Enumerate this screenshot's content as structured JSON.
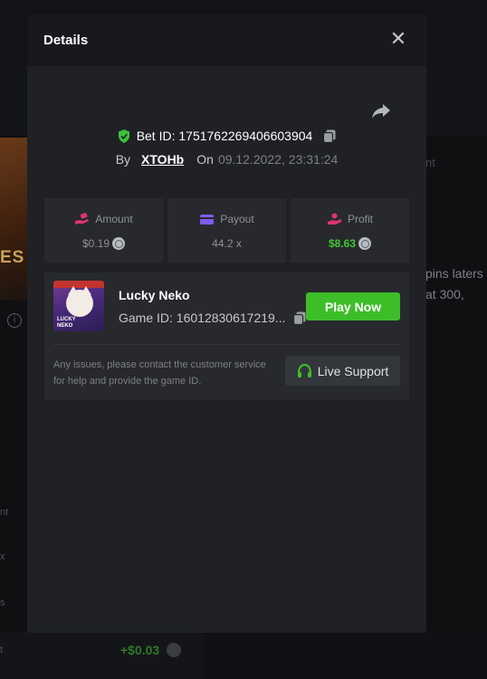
{
  "background": {
    "left_card_text": "ES",
    "right_text_top": "nt",
    "right_text_line1": "pins laters",
    "right_text_line2": "at 300,",
    "left_labels": [
      "nt",
      "x",
      "s",
      "t"
    ],
    "profit_value": "+$0.03"
  },
  "modal": {
    "title": "Details",
    "close_icon": "close-icon",
    "share_icon": "share-icon",
    "bet": {
      "label": "Bet ID: 1751762269406603904",
      "by_label": "By",
      "user": "XTOHb",
      "on_label": "On",
      "date": "09.12.2022, 23:31:24"
    },
    "stats": [
      {
        "label": "Amount",
        "value": "$0.19",
        "icon": "hand-coins-icon",
        "color": "#e0346c"
      },
      {
        "label": "Payout",
        "value": "44.2 x",
        "icon": "card-icon",
        "color": "#7e5cf0"
      },
      {
        "label": "Profit",
        "value": "$8.63",
        "icon": "profit-icon",
        "color": "#e0346c"
      }
    ],
    "game": {
      "name": "Lucky Neko",
      "game_id": "Game ID: 16012830617219...",
      "thumb_logo_line1": "LUCKY",
      "thumb_logo_line2": "NEKO",
      "play_label": "Play Now",
      "notice": "Any issues, please contact the customer service for help and provide the game ID.",
      "support_label": "Live Support"
    }
  },
  "colors": {
    "accent_green": "#3dbe29",
    "profit_green": "#41c634"
  }
}
